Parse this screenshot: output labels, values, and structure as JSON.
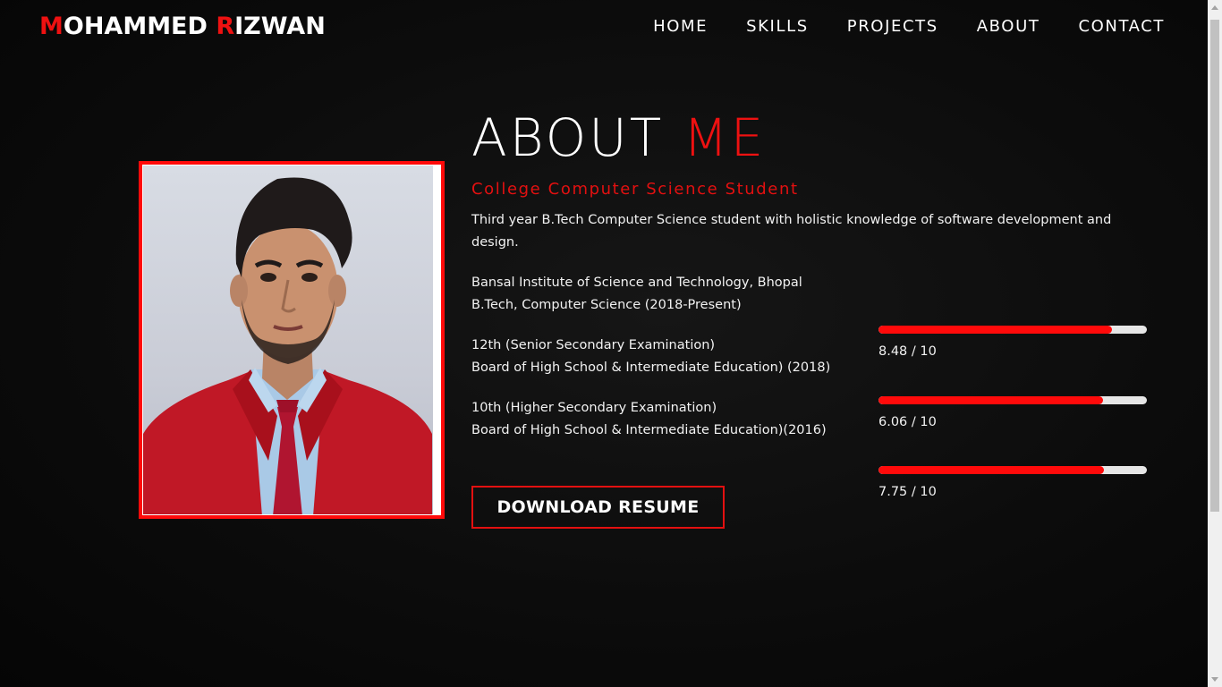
{
  "header": {
    "logo_first_initial": "M",
    "logo_first_rest": "OHAMMED ",
    "logo_last_initial": "R",
    "logo_last_rest": "IZWAN",
    "nav": [
      "HOME",
      "SKILLS",
      "PROJECTS",
      "ABOUT",
      "CONTACT"
    ]
  },
  "about": {
    "title_main": "ABOUT ",
    "title_accent": "ME",
    "subtitle": "College Computer Science Student",
    "intro": "Third year B.Tech Computer Science student with holistic knowledge of software development and design.",
    "education": [
      {
        "line1": "Bansal Institute of Science and Technology, Bhopal",
        "line2": "B.Tech, Computer Science (2018-Present)"
      },
      {
        "line1": "12th (Senior Secondary Examination)",
        "line2": "Board of High School & Intermediate Education) (2018)"
      },
      {
        "line1": "10th (Higher Secondary Examination)",
        "line2": "Board of High School & Intermediate Education)(2016)"
      }
    ],
    "scores": [
      {
        "label": "8.48 / 10",
        "fill_fraction": 0.87
      },
      {
        "label": "6.06 / 10",
        "fill_fraction": 0.835
      },
      {
        "label": "7.75 / 10",
        "fill_fraction": 0.84
      }
    ],
    "resume_button": "DOWNLOAD RESUME",
    "photo_icon": "profile-photo"
  },
  "colors": {
    "accent": "#ee1111",
    "background": "#0c0c0c",
    "text": "#ffffff",
    "track": "#e6e6e6"
  }
}
